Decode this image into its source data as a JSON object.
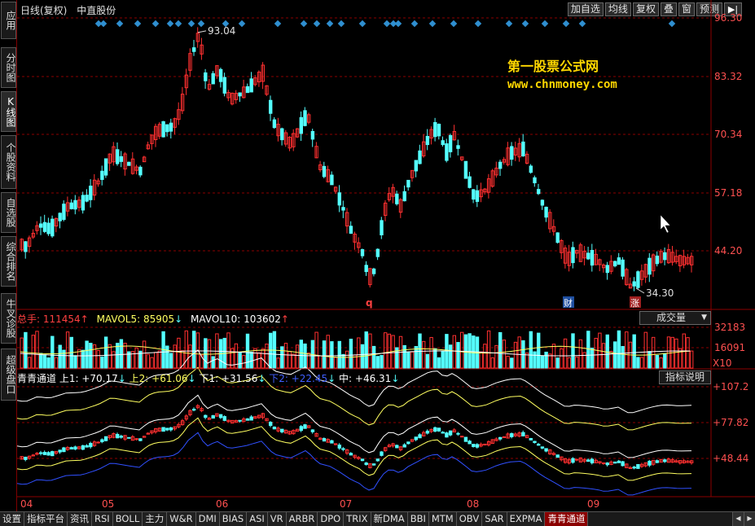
{
  "window": {
    "period_label": "日线(复权)",
    "stock_name": "中直股份",
    "toolbar": [
      "加自选",
      "均线",
      "复权",
      "叠",
      "窗",
      "预测"
    ],
    "nav_icon": "▶|"
  },
  "left_tabs": [
    {
      "label": "应用",
      "active": false
    },
    {
      "label": "分时图",
      "active": false
    },
    {
      "label": "K线图",
      "active": true
    },
    {
      "label": "个股资料",
      "active": false
    },
    {
      "label": "自选股",
      "active": false
    },
    {
      "label": "综合排名",
      "active": false
    },
    {
      "label": "牛叉诊股",
      "active": false
    },
    {
      "label": "超级盘口",
      "active": false
    }
  ],
  "watermark": {
    "line1": "第一股票公式网",
    "line2": "www.chnmoney.com"
  },
  "price_chart": {
    "y_ticks": [
      "96.30",
      "83.32",
      "70.34",
      "57.18",
      "44.20"
    ],
    "high_label": "93.04",
    "low_label": "34.30",
    "markers": [
      "q",
      "财",
      "涨"
    ]
  },
  "volume_panel": {
    "label": "总手: 111454",
    "ma5": "MAVOL5: 85905",
    "ma10": "MAVOL10: 103602",
    "dropdown": "成交量",
    "y_ticks": [
      "32183",
      "16091"
    ],
    "unit": "X10"
  },
  "indicator_panel": {
    "name": "青青通道",
    "up1": "上1: +70.17",
    "up2": "上2: +61.06",
    "down1": "下1: +31.56",
    "down2": "下2: +22.45",
    "mid": "中: +46.31",
    "help": "指标说明",
    "y_ticks": [
      "+107.2",
      "+77.82",
      "+48.44"
    ]
  },
  "x_axis": [
    "04",
    "05",
    "06",
    "07",
    "08",
    "09"
  ],
  "bottom_tabs": [
    "设置",
    "指标平台",
    "资讯",
    "RSI",
    "BOLL",
    "主力",
    "W&R",
    "DMI",
    "BIAS",
    "ASI",
    "VR",
    "ARBR",
    "DPO",
    "TRIX",
    "新DMA",
    "BBI",
    "MTM",
    "OBV",
    "SAR",
    "EXPMA",
    "青青通道"
  ],
  "active_bottom_tab": "青青通道",
  "colors": {
    "up": "#ff3030",
    "down": "#54ffff",
    "grid": "#8b0000",
    "axis_text": "#ff5050",
    "marker": "#2f8fd0"
  }
}
